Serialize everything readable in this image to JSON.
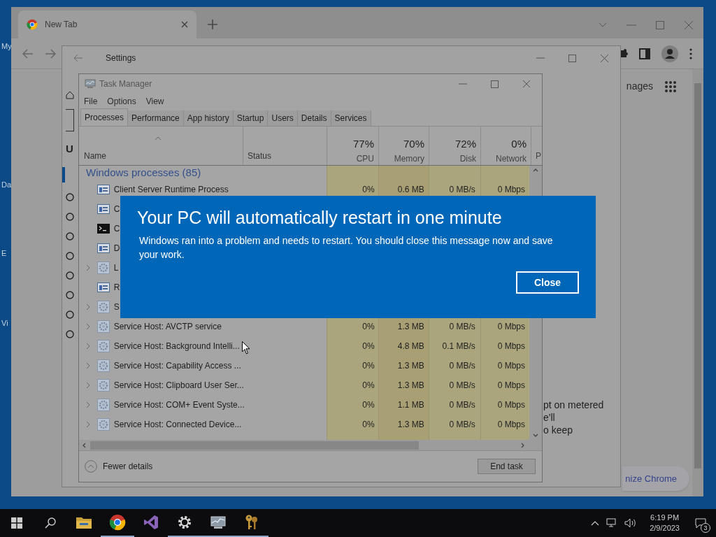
{
  "desktop": {
    "icon_labels": [
      "My",
      "Da",
      "E",
      "Vi"
    ]
  },
  "browser": {
    "tabs": [
      {
        "label": "New Tab",
        "selected": true
      }
    ],
    "header_text": "nages",
    "customize_button": "nize Chrome"
  },
  "settings": {
    "title": "Settings",
    "heading_letter": "U",
    "text_lines": [
      "pt on metered",
      "e'll",
      "o keep"
    ]
  },
  "task_manager": {
    "title": "Task Manager",
    "menu": [
      "File",
      "Options",
      "View"
    ],
    "tabs": [
      {
        "label": "Processes",
        "selected": true
      },
      {
        "label": "Performance",
        "selected": false
      },
      {
        "label": "App history",
        "selected": false
      },
      {
        "label": "Startup",
        "selected": false
      },
      {
        "label": "Users",
        "selected": false
      },
      {
        "label": "Details",
        "selected": false
      },
      {
        "label": "Services",
        "selected": false
      }
    ],
    "name_column": "Name",
    "status_column": "Status",
    "metrics": [
      {
        "percent": "77%",
        "label": "CPU"
      },
      {
        "percent": "70%",
        "label": "Memory"
      },
      {
        "percent": "72%",
        "label": "Disk"
      },
      {
        "percent": "0%",
        "label": "Network"
      }
    ],
    "cut_column": "P",
    "group": "Windows processes (85)",
    "rows": [
      {
        "name": "Client Server Runtime Process",
        "kind": "window",
        "expandable": false,
        "cpu": "0%",
        "memory": "0.6 MB",
        "disk": "0 MB/s",
        "network": "0 Mbps"
      },
      {
        "name": "C",
        "kind": "window",
        "expandable": false
      },
      {
        "name": "C",
        "kind": "console",
        "expandable": false
      },
      {
        "name": "D",
        "kind": "window",
        "expandable": false
      },
      {
        "name": "L",
        "kind": "gear",
        "expandable": true
      },
      {
        "name": "R",
        "kind": "window",
        "expandable": false
      },
      {
        "name": "S",
        "kind": "gear",
        "expandable": true
      },
      {
        "name": "Service Host: AVCTP service",
        "kind": "gear",
        "expandable": true,
        "cpu": "0%",
        "memory": "1.3 MB",
        "disk": "0 MB/s",
        "network": "0 Mbps"
      },
      {
        "name": "Service Host: Background Intelli...",
        "kind": "gear",
        "expandable": true,
        "cpu": "0%",
        "memory": "4.8 MB",
        "disk": "0.1 MB/s",
        "network": "0 Mbps"
      },
      {
        "name": "Service Host: Capability Access ...",
        "kind": "gear",
        "expandable": true,
        "cpu": "0%",
        "memory": "1.3 MB",
        "disk": "0 MB/s",
        "network": "0 Mbps"
      },
      {
        "name": "Service Host: Clipboard User Ser...",
        "kind": "gear",
        "expandable": true,
        "cpu": "0%",
        "memory": "1.3 MB",
        "disk": "0 MB/s",
        "network": "0 Mbps"
      },
      {
        "name": "Service Host: COM+ Event Syste...",
        "kind": "gear",
        "expandable": true,
        "cpu": "0%",
        "memory": "1.1 MB",
        "disk": "0 MB/s",
        "network": "0 Mbps"
      },
      {
        "name": "Service Host: Connected Device...",
        "kind": "gear",
        "expandable": true,
        "cpu": "0%",
        "memory": "1.3 MB",
        "disk": "0 MB/s",
        "network": "0 Mbps"
      }
    ],
    "fewer_details": "Fewer details",
    "end_task": "End task"
  },
  "dialog": {
    "title": "Your PC will automatically restart in one minute",
    "message": "Windows ran into a problem and needs to restart. You should close this message now and save your work.",
    "button": "Close"
  },
  "taskbar": {
    "apps": [
      {
        "kind": "explorer",
        "running": false
      },
      {
        "kind": "chrome",
        "running": true
      },
      {
        "kind": "studio",
        "running": false
      },
      {
        "kind": "settings",
        "running": true
      },
      {
        "kind": "taskmanager",
        "running": true
      },
      {
        "kind": "keys",
        "running": true
      }
    ],
    "time": "6:19 PM",
    "date": "2/9/2023",
    "notifications": "3"
  }
}
